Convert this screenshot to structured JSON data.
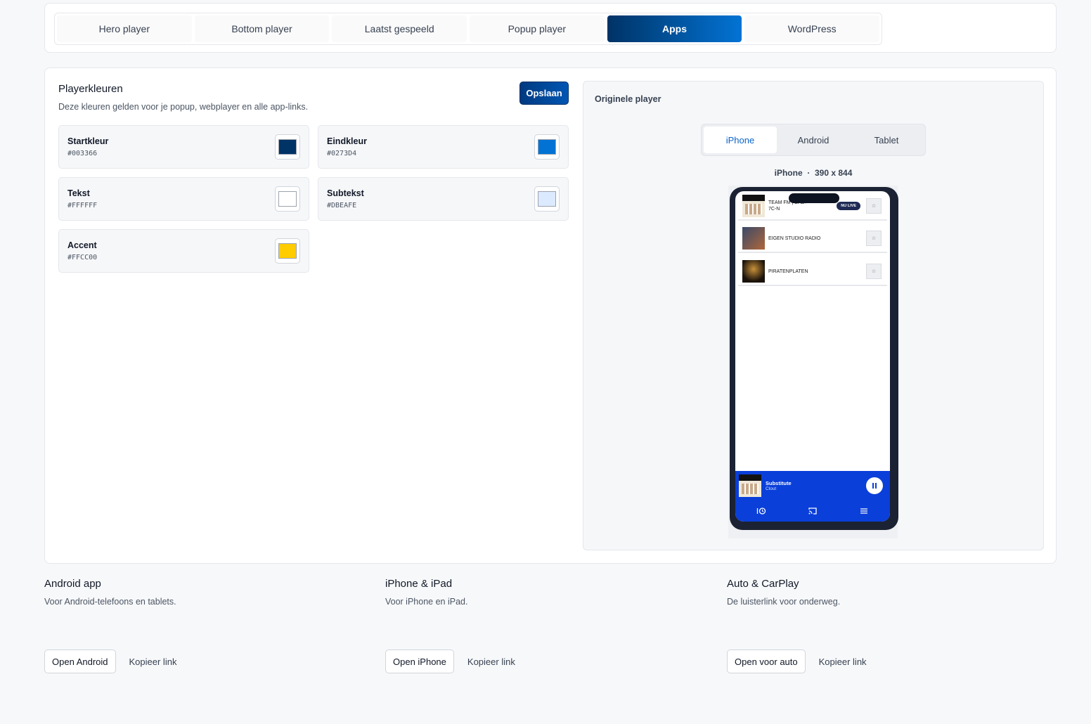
{
  "tabs": [
    {
      "label": "Hero player",
      "active": false
    },
    {
      "label": "Bottom player",
      "active": false
    },
    {
      "label": "Laatst gespeeld",
      "active": false
    },
    {
      "label": "Popup player",
      "active": false
    },
    {
      "label": "Apps",
      "active": true
    },
    {
      "label": "WordPress",
      "active": false
    }
  ],
  "colors_section": {
    "title": "Playerkleuren",
    "subtitle": "Deze kleuren gelden voor je popup, webplayer en alle app-links.",
    "save_label": "Opslaan",
    "swatches": [
      {
        "label": "Startkleur",
        "hex": "#003366"
      },
      {
        "label": "Eindkleur",
        "hex": "#0273D4"
      },
      {
        "label": "Tekst",
        "hex": "#FFFFFF"
      },
      {
        "label": "Subtekst",
        "hex": "#DBEAFE"
      },
      {
        "label": "Accent",
        "hex": "#FFCC00"
      }
    ]
  },
  "preview": {
    "title": "Originele player",
    "device_tabs": [
      {
        "label": "iPhone",
        "active": true
      },
      {
        "label": "Android",
        "active": false
      },
      {
        "label": "Tablet",
        "active": false
      }
    ],
    "device_name": "iPhone",
    "separator": "·",
    "device_size": "390 x 844",
    "phone": {
      "stations": [
        {
          "name": "TEAM FM | DAB+ 7C-N",
          "badge": "NU LIVE",
          "thumb": "clout"
        },
        {
          "name": "EIGEN STUDIO RADIO",
          "badge": "",
          "thumb": "studio"
        },
        {
          "name": "PIRATENPLATEN",
          "badge": "",
          "thumb": "piraten"
        }
      ],
      "star_icon": "☆",
      "now_playing": {
        "title": "Substitute",
        "artist": "Clout"
      },
      "nav_icons": [
        "history-icon",
        "cast-icon",
        "menu-icon"
      ]
    }
  },
  "apps": [
    {
      "title": "Android app",
      "subtitle": "Voor Android-telefoons en tablets.",
      "open_label": "Open Android",
      "copy_label": "Kopieer link"
    },
    {
      "title": "iPhone & iPad",
      "subtitle": "Voor iPhone en iPad.",
      "open_label": "Open iPhone",
      "copy_label": "Kopieer link"
    },
    {
      "title": "Auto & CarPlay",
      "subtitle": "De luisterlink voor onderweg.",
      "open_label": "Open voor auto",
      "copy_label": "Kopieer link"
    }
  ]
}
